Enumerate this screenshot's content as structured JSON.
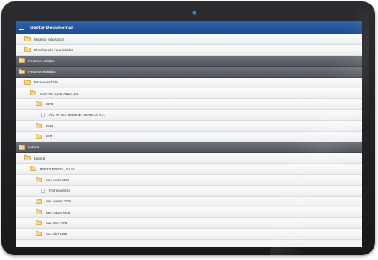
{
  "app": {
    "title": "Gestor Documental",
    "menu_icon": "hamburger-menu-icon"
  },
  "rows": [
    {
      "label": "Modelos exportación",
      "type": "folder",
      "level": 1,
      "style": "light"
    },
    {
      "label": "Plantillas alta de entidades",
      "type": "folder",
      "level": 1,
      "style": "light"
    },
    {
      "label": "Facturas emitidas",
      "type": "folder",
      "level": 0,
      "style": "dark"
    },
    {
      "label": "Facturas recibidas",
      "type": "folder",
      "level": 0,
      "style": "dark"
    },
    {
      "label": "Factura recibida",
      "type": "folder",
      "level": 1,
      "style": "light"
    },
    {
      "label": "CENTRO CONTABLE 001",
      "type": "folder",
      "level": 2,
      "style": "light"
    },
    {
      "label": "2009",
      "type": "folder",
      "level": 3,
      "style": "light"
    },
    {
      "label": "Fra. 77 Doc. 80000 de MERGAM, S.A.",
      "type": "doc",
      "level": 4,
      "style": "light"
    },
    {
      "label": "2010",
      "type": "folder",
      "level": 3,
      "style": "light"
    },
    {
      "label": "2011",
      "type": "folder",
      "level": 3,
      "style": "light"
    },
    {
      "label": "Laboral",
      "type": "folder",
      "level": 0,
      "style": "dark"
    },
    {
      "label": "Laboral",
      "type": "folder",
      "level": 1,
      "style": "light"
    },
    {
      "label": "PEREZ RIVERA, JULIA",
      "type": "folder",
      "level": 2,
      "style": "light"
    },
    {
      "label": "Mes enero 2009",
      "type": "folder",
      "level": 3,
      "style": "light"
    },
    {
      "label": "Nómina enero",
      "type": "doc",
      "level": 4,
      "style": "light"
    },
    {
      "label": "Mes febrero 2009",
      "type": "folder",
      "level": 3,
      "style": "light"
    },
    {
      "label": "Mes marzo 2009",
      "type": "folder",
      "level": 3,
      "style": "light"
    },
    {
      "label": "Mes abril 2009",
      "type": "folder",
      "level": 3,
      "style": "light"
    },
    {
      "label": "Mes abril 2009",
      "type": "folder",
      "level": 3,
      "style": "light"
    }
  ],
  "colors": {
    "header_blue": "#2a5aa3",
    "dark_row": "#5a5e65",
    "light_row": "#f1f2f4",
    "folder_yellow": "#f4d78a"
  }
}
